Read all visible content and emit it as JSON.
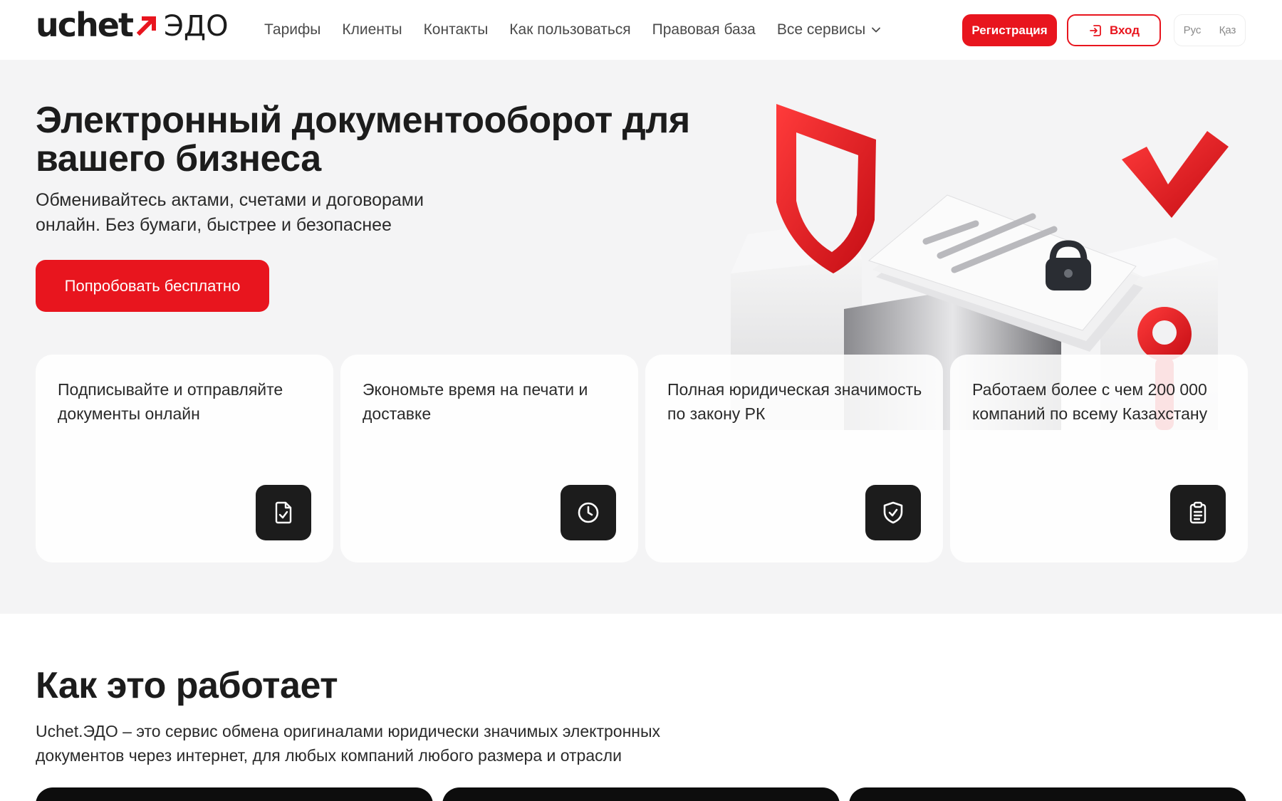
{
  "header": {
    "logo_word": "uchet",
    "logo_suffix": "ЭДО",
    "nav": [
      {
        "label": "Тарифы"
      },
      {
        "label": "Клиенты"
      },
      {
        "label": "Контакты"
      },
      {
        "label": "Как пользоваться"
      },
      {
        "label": "Правовая база"
      },
      {
        "label": "Все сервисы",
        "icon": "chevron-down-icon"
      }
    ],
    "register_label": "Регистрация",
    "login_label": "Вход",
    "login_icon": "login-icon",
    "lang": [
      "Рус",
      "Қаз"
    ]
  },
  "hero": {
    "title": "Электронный документооборот для вашего бизнеса",
    "subtitle": "Обменивайтесь актами, счетами и договорами онлайн. Без бумаги, быстрее и безопаснее",
    "cta_label": "Попробовать бесплатно",
    "features": [
      {
        "text": "Подписывайте и отправляйте документы онлайн",
        "icon": "document-check-icon"
      },
      {
        "text": "Экономьте время на печати и доставке",
        "icon": "clock-icon"
      },
      {
        "text": "Полная юридическая значимость по закону РК",
        "icon": "shield-check-icon"
      },
      {
        "text": "Работаем более с чем 200 000 компаний по всему Казахстану",
        "icon": "clipboard-icon"
      }
    ]
  },
  "how": {
    "title": "Как это работает",
    "description": "Uchet.ЭДО – это сервис обмена оригиналами юридически значимых электронных документов через интернет, для любых компаний любого размера и отрасли"
  },
  "colors": {
    "accent": "#e8151e",
    "dark": "#1c1c1c",
    "hero_bg": "#f4f4f5"
  }
}
